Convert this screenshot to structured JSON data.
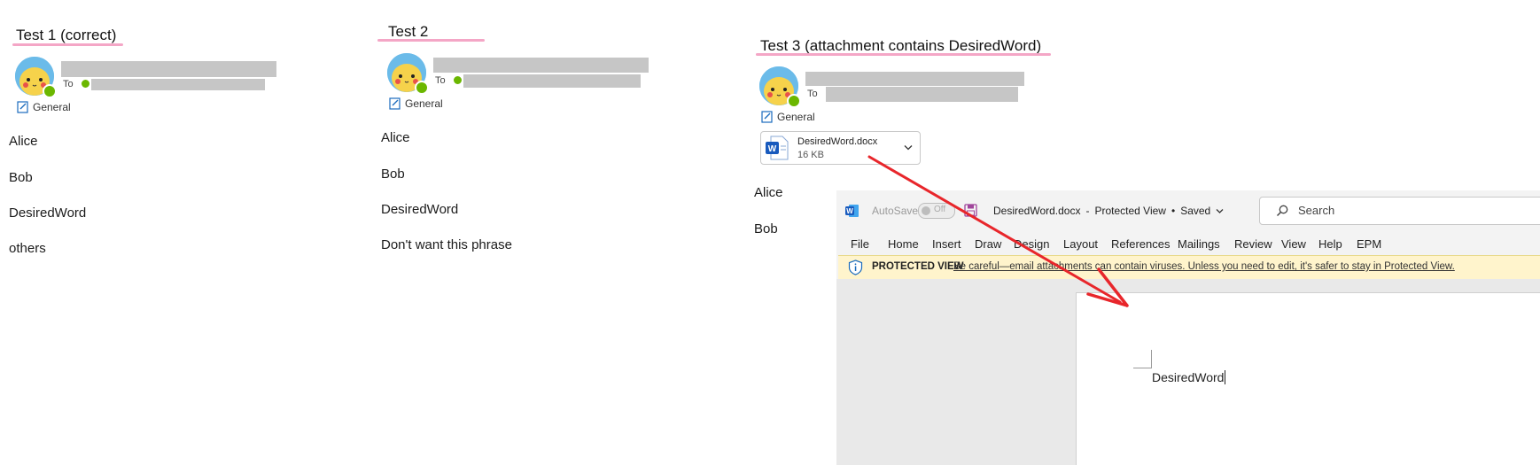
{
  "tests": [
    {
      "title": "Test 1 (correct)",
      "to_label": "To",
      "tag": "General",
      "lines": [
        "Alice",
        "Bob",
        "DesiredWord",
        "others"
      ]
    },
    {
      "title": "Test 2",
      "to_label": "To",
      "tag": "General",
      "lines": [
        "Alice",
        "Bob",
        "DesiredWord",
        "Don't want this phrase"
      ]
    },
    {
      "title": "Test 3 (attachment contains DesiredWord)",
      "to_label": "To",
      "tag": "General",
      "attachment": {
        "name": "DesiredWord.docx",
        "size": "16 KB"
      },
      "lines": [
        "Alice",
        "Bob"
      ]
    }
  ],
  "word": {
    "autosave_label": "AutoSave",
    "autosave_state": "Off",
    "doc_title": "DesiredWord.docx",
    "separator": "-",
    "view_status": "Protected View",
    "bullet": "•",
    "saved": "Saved",
    "search_placeholder": "Search",
    "menu": [
      "File",
      "Home",
      "Insert",
      "Draw",
      "Design",
      "Layout",
      "References",
      "Mailings",
      "Review",
      "View",
      "Help",
      "EPM"
    ],
    "protected_label": "PROTECTED VIEW",
    "protected_message": "Be careful—email attachments can contain viruses. Unless you need to edit, it's safer to stay in Protected View.",
    "doc_text": "DesiredWord"
  },
  "colors": {
    "underline": "#f4a6c6",
    "presence": "#6bb700",
    "arrow": "#e8262b",
    "word_blue": "#185abd",
    "protected_bg": "#fff4cc"
  }
}
